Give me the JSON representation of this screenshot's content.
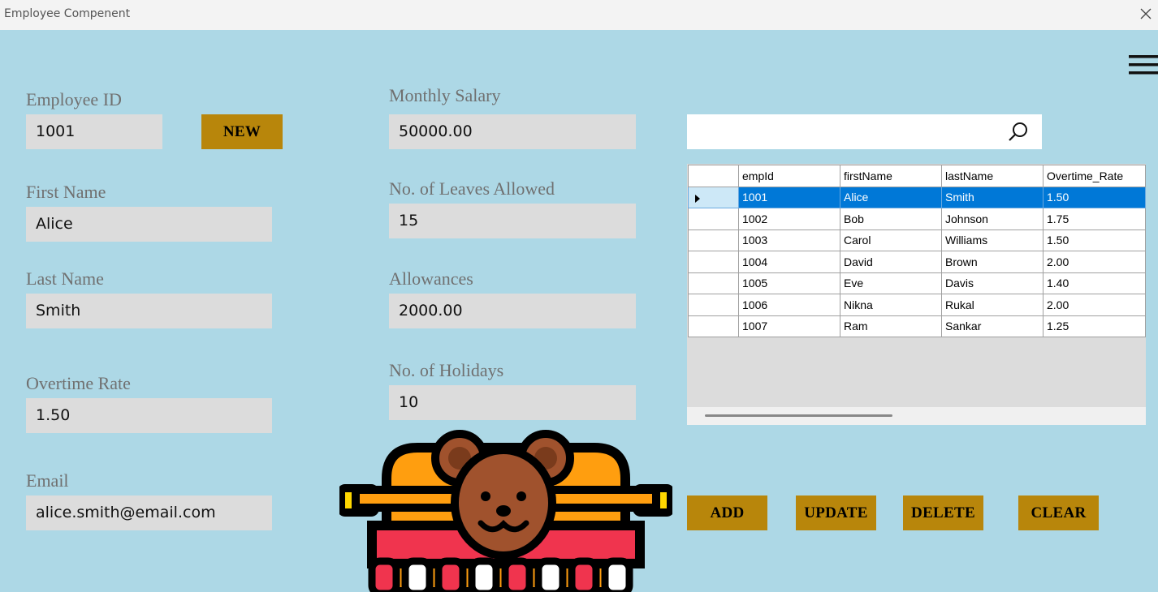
{
  "window": {
    "title": "Employee Compenent"
  },
  "form": {
    "employee_id": {
      "label": "Employee ID",
      "value": "1001"
    },
    "new_button": "NEW",
    "first_name": {
      "label": "First Name",
      "value": "Alice"
    },
    "last_name": {
      "label": "Last Name",
      "value": "Smith"
    },
    "overtime_rate": {
      "label": "Overtime Rate",
      "value": "1.50"
    },
    "email": {
      "label": "Email",
      "value": "alice.smith@email.com"
    },
    "monthly_salary": {
      "label": "Monthly Salary",
      "value": "50000.00"
    },
    "leaves_allowed": {
      "label": "No. of Leaves Allowed",
      "value": "15"
    },
    "allowances": {
      "label": "Allowances",
      "value": "2000.00"
    },
    "holidays": {
      "label": "No. of Holidays",
      "value": "10"
    }
  },
  "search": {
    "value": "",
    "icon": "search-icon"
  },
  "grid": {
    "columns": [
      "empId",
      "firstName",
      "lastName",
      "Overtime_Rate"
    ],
    "rows": [
      [
        "1001",
        "Alice",
        "Smith",
        "1.50"
      ],
      [
        "1002",
        "Bob",
        "Johnson",
        "1.75"
      ],
      [
        "1003",
        "Carol",
        "Williams",
        "1.50"
      ],
      [
        "1004",
        "David",
        "Brown",
        "2.00"
      ],
      [
        "1005",
        "Eve",
        "Davis",
        "1.40"
      ],
      [
        "1006",
        "Nikna",
        "Rukal",
        "2.00"
      ],
      [
        "1007",
        "Ram",
        "Sankar",
        "1.25"
      ]
    ],
    "selected_row": 0
  },
  "actions": {
    "add": "ADD",
    "update": "UPDATE",
    "delete": "DELETE",
    "clear": "CLEAR"
  },
  "colors": {
    "background": "#add8e6",
    "button": "#b8860b",
    "selection": "#0078d7",
    "field": "#dcdcdc"
  }
}
